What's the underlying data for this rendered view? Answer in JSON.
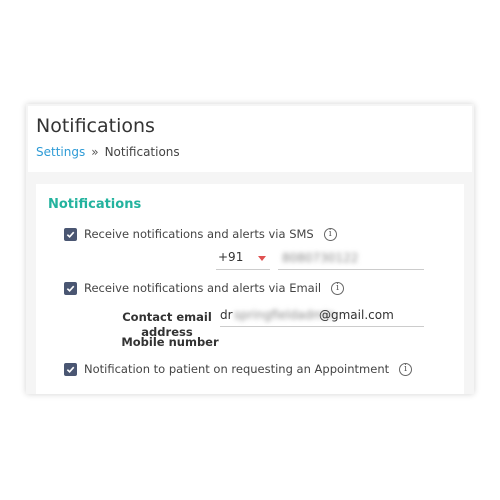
{
  "header": {
    "title": "Notifications",
    "breadcrumb": {
      "parent": "Settings",
      "separator": "»",
      "current": "Notifications"
    }
  },
  "section": {
    "title": "Notifications"
  },
  "sms": {
    "label": "Receive notifications and alerts via SMS",
    "checked": true,
    "mobile_label": "Mobile number",
    "country_code": "+91",
    "phone_masked": "8080730122"
  },
  "email": {
    "label": "Receive notifications and alerts via Email",
    "checked": true,
    "contact_label_line1": "Contact email",
    "contact_label_line2": "address",
    "value_prefix": "dr",
    "value_masked": "springfieldadmin",
    "value_domain": "@gmail.com"
  },
  "appointment": {
    "label": "Notification to patient on requesting an Appointment",
    "checked": true
  },
  "colors": {
    "accent": "#23b39e",
    "link": "#2e9bd6",
    "checkbox": "#4a5672",
    "caret": "#e05050"
  },
  "icons": {
    "check": "check-icon",
    "info": "info-icon",
    "dropdown": "chevron-down-icon"
  }
}
